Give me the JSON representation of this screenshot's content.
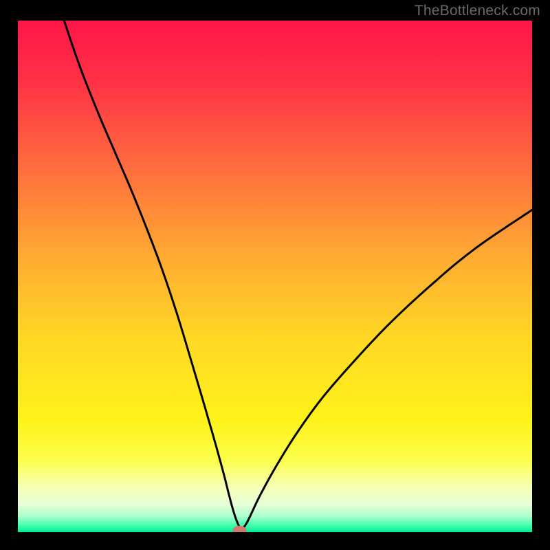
{
  "watermark": "TheBottleneck.com",
  "colors": {
    "background": "#000000",
    "curve": "#000000",
    "marker_fill": "#cf7a6e",
    "marker_stroke": "#9b564d",
    "gradient_stops": [
      {
        "offset": 0.0,
        "color": "#ff1648"
      },
      {
        "offset": 0.12,
        "color": "#ff3246"
      },
      {
        "offset": 0.28,
        "color": "#ff6a3e"
      },
      {
        "offset": 0.45,
        "color": "#ffa733"
      },
      {
        "offset": 0.62,
        "color": "#ffd824"
      },
      {
        "offset": 0.78,
        "color": "#fff21a"
      },
      {
        "offset": 0.86,
        "color": "#fbff4b"
      },
      {
        "offset": 0.91,
        "color": "#f6ffb3"
      },
      {
        "offset": 0.945,
        "color": "#e8ffd6"
      },
      {
        "offset": 0.97,
        "color": "#a7ffcd"
      },
      {
        "offset": 0.985,
        "color": "#4bffb0"
      },
      {
        "offset": 1.0,
        "color": "#00ef94"
      }
    ]
  },
  "chart_data": {
    "type": "line",
    "title": "",
    "xlabel": "",
    "ylabel": "",
    "xlim": [
      0,
      100
    ],
    "ylim": [
      0,
      100
    ],
    "series": [
      {
        "name": "bottleneck-curve",
        "x": [
          9,
          11,
          13,
          16,
          19,
          22,
          25,
          28,
          31,
          34,
          36.5,
          38.5,
          40,
          41,
          41.8,
          42.4,
          42.9,
          43.4,
          44.2,
          45.2,
          47,
          50,
          54,
          59,
          65,
          72,
          80,
          89,
          100
        ],
        "values": [
          100,
          94,
          88.5,
          81,
          74,
          67,
          59.5,
          51.5,
          42.5,
          32.5,
          24,
          17,
          11.5,
          7.5,
          4.5,
          2.6,
          1.4,
          0.6,
          1.3,
          3.2,
          7,
          12.5,
          19,
          26,
          33,
          40.5,
          48,
          55.5,
          63
        ]
      }
    ],
    "marker": {
      "x": 43.1,
      "y": 0.3,
      "rx": 1.35,
      "ry": 0.95
    }
  }
}
